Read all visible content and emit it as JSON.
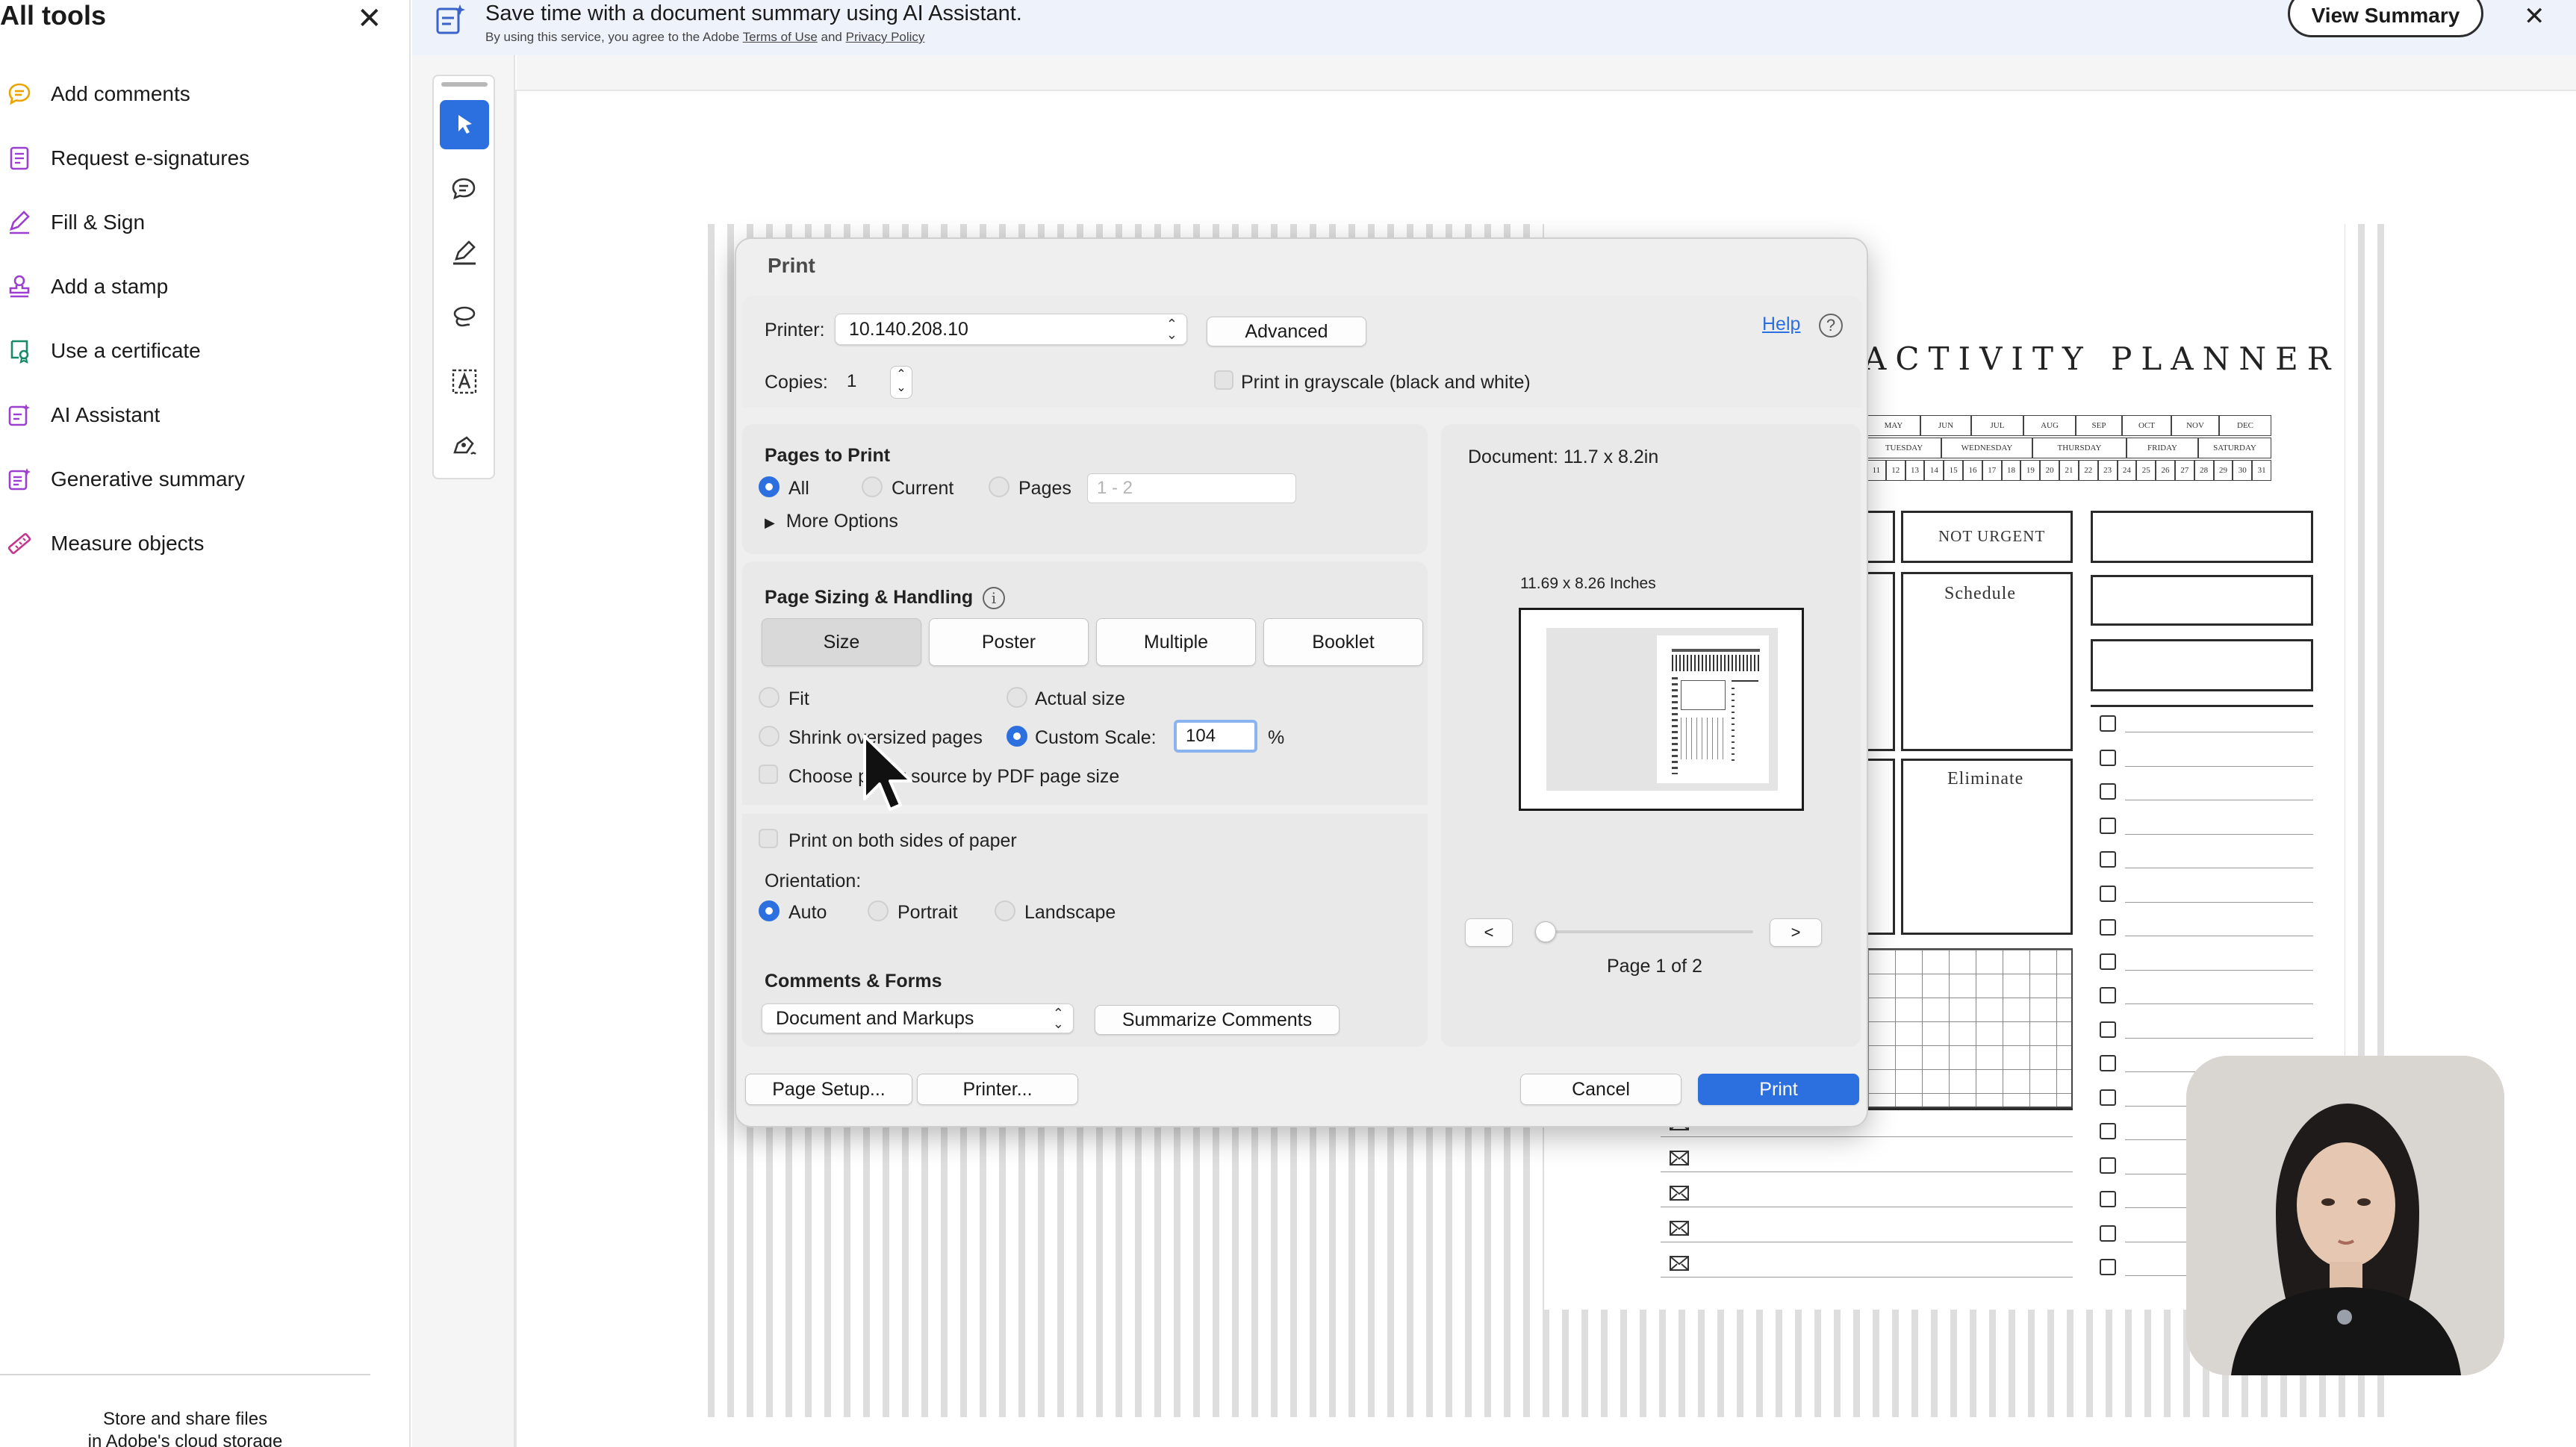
{
  "left_panel": {
    "title": "All tools",
    "close_icon": "close-icon",
    "items": [
      {
        "label": "Add comments",
        "icon": "comment-icon",
        "color": "#e8a400"
      },
      {
        "label": "Request e-signatures",
        "icon": "request-signature-icon",
        "color": "#9b3fd1"
      },
      {
        "label": "Fill & Sign",
        "icon": "fill-sign-icon",
        "color": "#9b3fd1"
      },
      {
        "label": "Add a stamp",
        "icon": "stamp-icon",
        "color": "#9b3fd1"
      },
      {
        "label": "Use a certificate",
        "icon": "certificate-icon",
        "color": "#178a6a"
      },
      {
        "label": "AI Assistant",
        "icon": "ai-assistant-icon",
        "color": "#9b3fd1"
      },
      {
        "label": "Generative summary",
        "icon": "generative-summary-icon",
        "color": "#9b3fd1"
      },
      {
        "label": "Measure objects",
        "icon": "measure-icon",
        "color": "#c4348c"
      }
    ],
    "footer_line1": "Store and share files",
    "footer_line2": "in Adobe's cloud storage"
  },
  "banner": {
    "title": "Save time with a document summary using AI Assistant.",
    "sub_prefix": "By using this service, you agree to the Adobe",
    "terms_link": "Terms of Use",
    "and_text": "and",
    "privacy_link": "Privacy Policy",
    "view_summary": "View Summary",
    "close_icon": "close-icon"
  },
  "tool_rail": [
    "select-pointer-icon",
    "add-comment-icon",
    "highlight-pen-icon",
    "draw-lasso-icon",
    "text-recognition-icon",
    "sign-pen-icon"
  ],
  "planner": {
    "title": "ACTIVITY PLANNER",
    "months": [
      "MAY",
      "JUN",
      "JUL",
      "AUG",
      "SEP",
      "OCT",
      "NOV",
      "DEC"
    ],
    "weekdays": [
      "TUESDAY",
      "WEDNESDAY",
      "THURSDAY",
      "FRIDAY",
      "SATURDAY"
    ],
    "days": [
      "11",
      "12",
      "13",
      "14",
      "15",
      "16",
      "17",
      "18",
      "19",
      "20",
      "21",
      "22",
      "23",
      "24",
      "25",
      "26",
      "27",
      "28",
      "29",
      "30",
      "31"
    ],
    "not_urgent": "NOT URGENT",
    "schedule": "Schedule",
    "eliminate": "Eliminate"
  },
  "print_dialog": {
    "title": "Print",
    "printer_label": "Printer:",
    "printer_value": "10.140.208.10",
    "advanced": "Advanced",
    "help": "Help",
    "copies_label": "Copies:",
    "copies_value": "1",
    "grayscale": "Print in grayscale (black and white)",
    "grayscale_checked": false,
    "pages_to_print": {
      "heading": "Pages to Print",
      "all": "All",
      "current": "Current",
      "pages": "Pages",
      "pages_placeholder": "1 - 2",
      "selected": "All",
      "more_options": "More Options"
    },
    "page_sizing": {
      "heading": "Page Sizing & Handling",
      "tabs": [
        "Size",
        "Poster",
        "Multiple",
        "Booklet"
      ],
      "active_tab": "Size",
      "fit": "Fit",
      "actual_size": "Actual size",
      "shrink": "Shrink oversized pages",
      "custom_scale": "Custom Scale:",
      "custom_scale_value": "104",
      "percent": "%",
      "selected": "Custom Scale:",
      "choose_source": "Choose paper source by PDF page size",
      "both_sides": "Print on both sides of paper",
      "orientation_label": "Orientation:",
      "auto": "Auto",
      "portrait": "Portrait",
      "landscape": "Landscape",
      "orientation_selected": "Auto"
    },
    "comments_forms": {
      "heading": "Comments & Forms",
      "value": "Document and Markups",
      "summarize": "Summarize Comments"
    },
    "preview": {
      "document_size": "Document: 11.7 x 8.2in",
      "paper_size": "11.69 x 8.26 Inches",
      "prev": "<",
      "next": ">",
      "page_indicator": "Page 1 of 2"
    },
    "buttons": {
      "page_setup": "Page Setup...",
      "printer": "Printer...",
      "cancel": "Cancel",
      "print": "Print"
    }
  },
  "colors": {
    "accent": "#2c6fde",
    "banner_bg": "#eef3fb"
  }
}
